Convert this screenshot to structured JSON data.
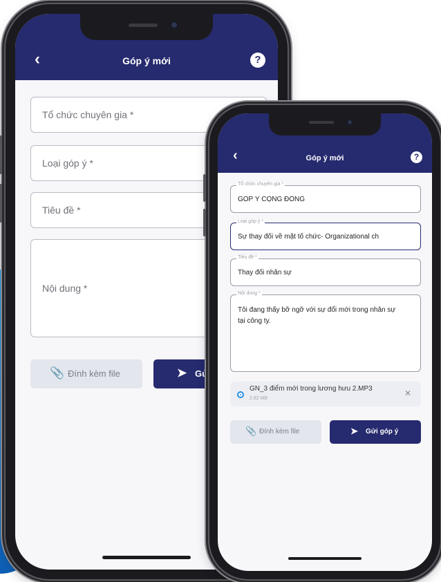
{
  "colors": {
    "primary": "#262a6e",
    "background": "#f7f7fa",
    "accent_splash": "#1a8fe8"
  },
  "back_phone": {
    "appbar": {
      "back_icon": "chevron-left-icon",
      "title": "Góp ý mới",
      "help_icon": "question-circle-icon",
      "help_glyph": "?"
    },
    "form": {
      "organization_placeholder": "Tổ chức chuyên gia *",
      "type_placeholder": "Loại góp ý *",
      "title_placeholder": "Tiêu đề *",
      "content_placeholder": "Nội dung *"
    },
    "attach_button": {
      "icon": "paperclip-icon",
      "label": "Đính kèm file"
    },
    "send_button": {
      "icon": "send-icon",
      "label": "Gử"
    }
  },
  "front_phone": {
    "appbar": {
      "back_icon": "chevron-left-icon",
      "title": "Góp ý mới",
      "help_icon": "question-circle-icon",
      "help_glyph": "?"
    },
    "form": {
      "organization": {
        "label": "Tổ chức chuyên gia *",
        "value": "GÓP Ý CỘNG ĐỒNG"
      },
      "type": {
        "label": "Loại góp ý *",
        "value": "Sự thay đổi về mặt tổ chức- Organizational ch"
      },
      "title": {
        "label": "Tiêu đề *",
        "value": "Thay đổi nhân sự"
      },
      "content": {
        "label": "Nội dung *",
        "value": "Tôi đang thấy bỡ ngỡ với sự đổi mới trong nhân sự tại công ty."
      }
    },
    "attachment": {
      "icon": "radio-selected-icon",
      "name": "GN_3 điểm mới trong lương hưu 2.MP3",
      "size": "2.82 MB",
      "remove_icon": "close-icon",
      "remove_glyph": "✕"
    },
    "attach_button": {
      "icon": "paperclip-icon",
      "label": "Đính kèm file"
    },
    "send_button": {
      "icon": "send-icon",
      "label": "Gửi góp ý"
    }
  }
}
